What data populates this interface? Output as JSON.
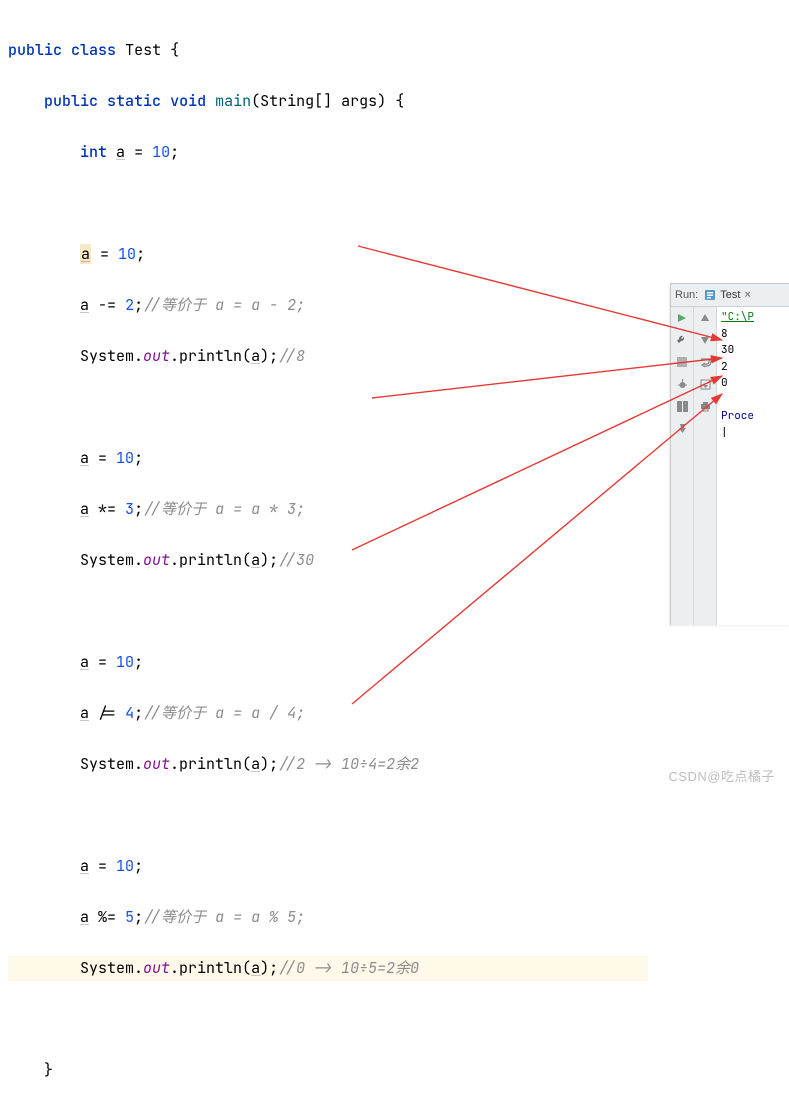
{
  "code": {
    "kw_public": "public",
    "kw_class": "class",
    "cls_name": "Test",
    "kw_static": "static",
    "kw_void": "void",
    "fn_main": "main",
    "type_string": "String",
    "param_args": "args",
    "kw_int": "int",
    "var_a": "a",
    "eq": "=",
    "semi": ";",
    "line_decl_val": "10",
    "assign10": "10",
    "sub_op": "-=",
    "sub_val": "2",
    "sub_comment": "//等价于 a = a - 2;",
    "print_prefix": "System.",
    "print_out": "out",
    "print_call": ".println(",
    "print_close": ");",
    "c_8": "//8",
    "mul_op": "*=",
    "mul_val": "3",
    "mul_comment": "//等价于 a = a * 3;",
    "c_30": "//30",
    "div_op": "/=",
    "div_val": "4",
    "div_comment": "//等价于 a = a / 4;",
    "c_2": "//2 -> 10÷4=2余2",
    "mod_op": "%=",
    "mod_val": "5",
    "mod_comment": "//等价于 a = a % 5;",
    "c_0": "//0 -> 10÷5=2余0"
  },
  "run": {
    "label": "Run:",
    "tab": "Test",
    "path": "\"C:\\P",
    "out1": "8",
    "out2": "30",
    "out3": "2",
    "out4": "0",
    "proc": "Proce"
  },
  "watermark": "CSDN@吃点橘子"
}
